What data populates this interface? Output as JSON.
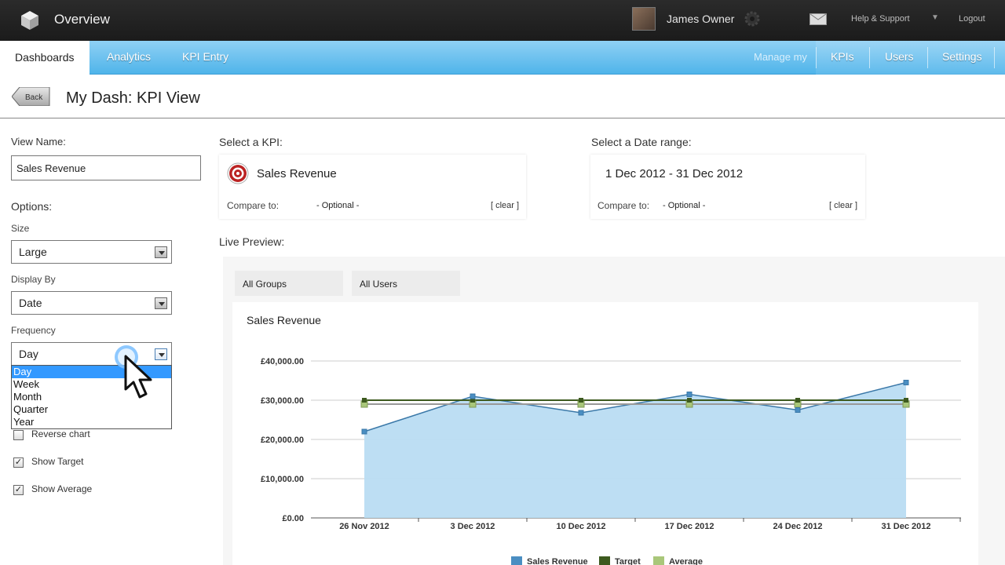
{
  "header": {
    "app_title": "Overview",
    "user_name": "James Owner",
    "help": "Help & Support",
    "logout": "Logout"
  },
  "nav": {
    "tabs": [
      {
        "label": "Dashboards"
      },
      {
        "label": "Analytics"
      },
      {
        "label": "KPI Entry"
      }
    ],
    "manage": "Manage my",
    "right_tabs": [
      {
        "label": "KPIs"
      },
      {
        "label": "Users"
      },
      {
        "label": "Settings"
      }
    ]
  },
  "page": {
    "back_label": "Back",
    "title": "My Dash: KPI View"
  },
  "form": {
    "view_name_label": "View Name:",
    "view_name_value": "Sales Revenue",
    "options_label": "Options:",
    "size_label": "Size",
    "size_value": "Large",
    "display_by_label": "Display By",
    "display_by_value": "Date",
    "frequency_label": "Frequency",
    "frequency_value": "Day",
    "frequency_options": [
      "Day",
      "Week",
      "Month",
      "Quarter",
      "Year"
    ],
    "reverse_chart": "Reverse chart",
    "show_target": "Show Target",
    "show_average": "Show Average"
  },
  "kpi": {
    "label": "Select a KPI:",
    "name": "Sales Revenue",
    "compare_label": "Compare to:",
    "optional": "- Optional -",
    "clear": "[ clear ]"
  },
  "date": {
    "label": "Select a Date range:",
    "range": "1 Dec 2012 - 31 Dec 2012",
    "compare_label": "Compare to:",
    "optional": "- Optional -",
    "clear": "[ clear ]"
  },
  "preview": {
    "label": "Live Preview:",
    "groups": "All Groups",
    "users": "All Users"
  },
  "colors": {
    "accent": "#4fb4ea",
    "area": "#b9dcf2",
    "line": "#3a78a8",
    "target": "#3d5a1f",
    "average": "#a9c77a"
  },
  "chart_data": {
    "type": "area",
    "title": "Sales Revenue",
    "categories": [
      "26 Nov 2012",
      "3 Dec 2012",
      "10 Dec 2012",
      "17 Dec 2012",
      "24 Dec 2012",
      "31 Dec 2012"
    ],
    "ylim": [
      0,
      40000
    ],
    "yticks": [
      "£0.00",
      "£10,000.00",
      "£20,000.00",
      "£30,000.00",
      "£40,000.00"
    ],
    "series": [
      {
        "name": "Sales Revenue",
        "values": [
          22000,
          31000,
          26800,
          31500,
          27500,
          34500
        ]
      },
      {
        "name": "Target",
        "values": [
          30000,
          30000,
          30000,
          30000,
          30000,
          30000
        ]
      },
      {
        "name": "Average",
        "values": [
          29000,
          29000,
          29000,
          29000,
          29000,
          29000
        ]
      }
    ],
    "grid": true,
    "legend": "bottom"
  }
}
